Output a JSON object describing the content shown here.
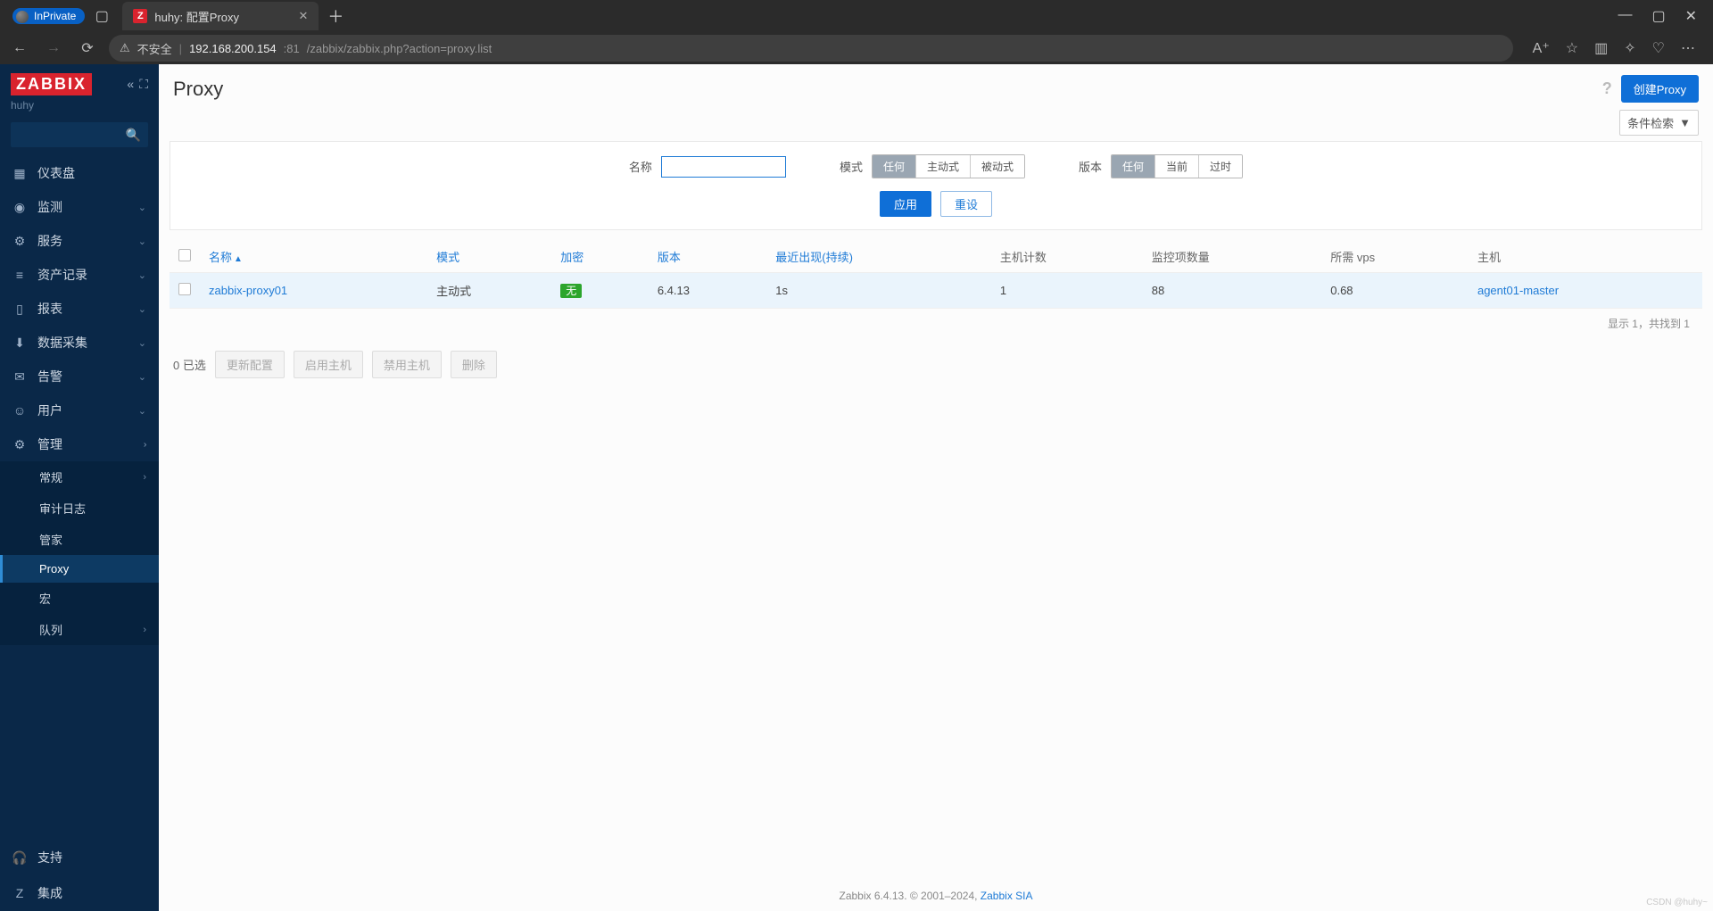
{
  "browser": {
    "inprivate": "InPrivate",
    "tab_title": "huhy: 配置Proxy",
    "url_insecure": "不安全",
    "url_host": "192.168.200.154",
    "url_port": ":81",
    "url_path": "/zabbix/zabbix.php?action=proxy.list"
  },
  "sidebar": {
    "logo": "ZABBIX",
    "user": "huhy",
    "items": [
      {
        "label": "仪表盘"
      },
      {
        "label": "监测"
      },
      {
        "label": "服务"
      },
      {
        "label": "资产记录"
      },
      {
        "label": "报表"
      },
      {
        "label": "数据采集"
      },
      {
        "label": "告警"
      },
      {
        "label": "用户"
      },
      {
        "label": "管理"
      }
    ],
    "admin_sub": [
      {
        "label": "常规"
      },
      {
        "label": "审计日志"
      },
      {
        "label": "管家"
      },
      {
        "label": "Proxy"
      },
      {
        "label": "宏"
      },
      {
        "label": "队列"
      }
    ],
    "bottom": [
      {
        "label": "支持"
      },
      {
        "label": "集成"
      }
    ]
  },
  "page": {
    "title": "Proxy",
    "create_btn": "创建Proxy",
    "filter_toggle": "条件检索"
  },
  "filter": {
    "name_label": "名称",
    "mode_label": "模式",
    "mode_opts": [
      "任何",
      "主动式",
      "被动式"
    ],
    "version_label": "版本",
    "version_opts": [
      "任何",
      "当前",
      "过时"
    ],
    "apply": "应用",
    "reset": "重设"
  },
  "table": {
    "headers": {
      "name": "名称",
      "mode": "模式",
      "encryption": "加密",
      "version": "版本",
      "last_seen": "最近出现(持续)",
      "host_count": "主机计数",
      "item_count": "监控项数量",
      "vps": "所需 vps",
      "hosts": "主机"
    },
    "rows": [
      {
        "name": "zabbix-proxy01",
        "mode": "主动式",
        "encryption": "无",
        "version": "6.4.13",
        "last_seen": "1s",
        "host_count": "1",
        "item_count": "88",
        "vps": "0.68",
        "host": "agent01-master"
      }
    ],
    "footer": "显示 1，共找到 1"
  },
  "bulk": {
    "selected": "0 已选",
    "update": "更新配置",
    "enable": "启用主机",
    "disable": "禁用主机",
    "delete": "删除"
  },
  "footer": {
    "text": "Zabbix 6.4.13. © 2001–2024, ",
    "link": "Zabbix SIA"
  },
  "watermark": "CSDN @huhy~"
}
